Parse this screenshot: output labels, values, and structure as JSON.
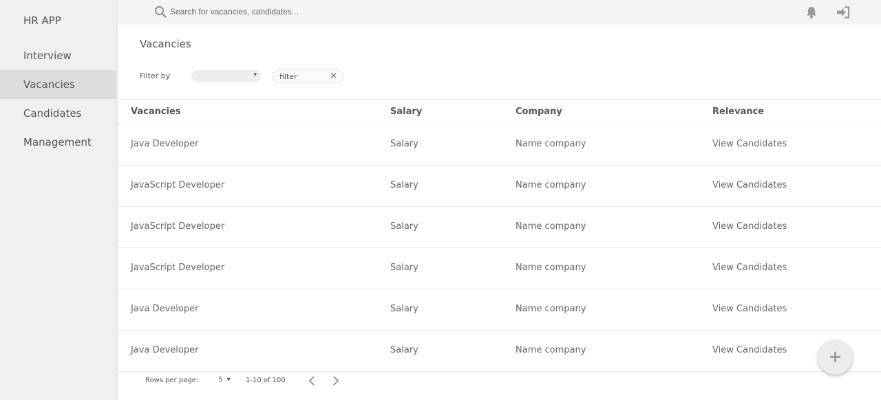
{
  "app": {
    "title": "HR APP"
  },
  "sidebar": {
    "items": [
      {
        "label": "Interview"
      },
      {
        "label": "Vacancies"
      },
      {
        "label": "Candidates"
      },
      {
        "label": "Management"
      }
    ],
    "active": "Vacancies"
  },
  "topbar": {
    "search_placeholder": "Search for vacancies, candidates...",
    "icons": [
      "search-icon",
      "bell-icon",
      "logout-icon"
    ]
  },
  "page": {
    "title": "Vacancies"
  },
  "filter": {
    "label": "Filter by",
    "select_value": "",
    "chip_text": "filter",
    "clear_icon": "×"
  },
  "table": {
    "columns": [
      "Vacancies",
      "Salary",
      "Company",
      "Relevance"
    ],
    "rows": [
      [
        "Java Developer",
        "Salary",
        "Name company",
        "View Candidates"
      ],
      [
        "JavaScript Developer",
        "Salary",
        "Name company",
        "View Candidates"
      ],
      [
        "JavaScript Developer",
        "Salary",
        "Name company",
        "View Candidates"
      ],
      [
        "JavaScript Developer",
        "Salary",
        "Name company",
        "View Candidates"
      ],
      [
        "Java Developer",
        "Salary",
        "Name company",
        "View Candidates"
      ],
      [
        "Java Developer",
        "Salary",
        "Name company",
        "View Candidates"
      ]
    ]
  },
  "pagination": {
    "rows_label": "Rows per page:",
    "rows_value": "5",
    "caret": "▾",
    "range": "1-10 of 100"
  },
  "fab": {
    "label": "+"
  },
  "colors": {
    "sidebar_bg": "#f0f0f0",
    "active_bg": "#dcdcdc",
    "text": "#555555"
  }
}
